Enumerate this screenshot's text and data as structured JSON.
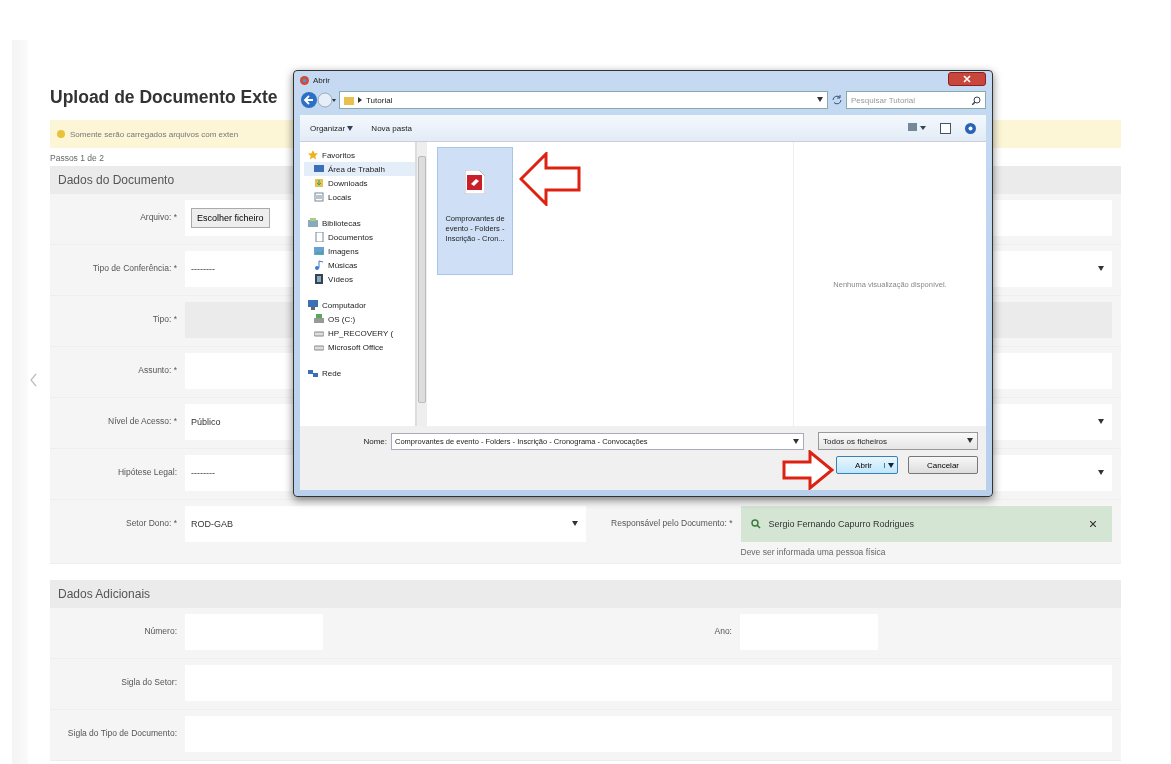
{
  "page": {
    "title": "Upload de Documento Exte",
    "alert": "Somente serão carregados arquivos com exten",
    "steps": "Passos 1 de 2"
  },
  "sections": [
    {
      "title": "Dados do Documento",
      "rows": [
        {
          "fields": [
            {
              "kind": "file",
              "label": "Arquivo: *",
              "value": "Escolher ficheiro"
            }
          ]
        },
        {
          "fields": [
            {
              "kind": "select",
              "label": "Tipo de Conferência: *",
              "value": "--------"
            }
          ]
        },
        {
          "fields": [
            {
              "kind": "disabled",
              "label": "Tipo: *"
            }
          ]
        },
        {
          "fields": [
            {
              "kind": "text",
              "label": "Assunto: *"
            }
          ]
        },
        {
          "fields": [
            {
              "kind": "select",
              "label": "Nível de Acesso: *",
              "value": "Público"
            }
          ]
        },
        {
          "fields": [
            {
              "kind": "select",
              "label": "Hipótese Legal:",
              "value": "--------"
            }
          ]
        },
        {
          "fields": [
            {
              "kind": "select",
              "label": "Setor Dono: *",
              "value": "ROD-GAB"
            },
            {
              "kind": "person",
              "label": "Responsável pelo Documento: *",
              "value": "Sergio Fernando Capurro Rodrigues",
              "help": "Deve ser informada uma pessoa física"
            }
          ]
        }
      ]
    },
    {
      "title": "Dados Adicionais",
      "rows": [
        {
          "fields": [
            {
              "kind": "short",
              "label": "Número:"
            },
            {
              "kind": "short",
              "label": "Ano:"
            }
          ]
        },
        {
          "fields": [
            {
              "kind": "text",
              "label": "Sigla do Setor:"
            }
          ]
        },
        {
          "fields": [
            {
              "kind": "text",
              "label": "Sigla do Tipo de Documento:"
            }
          ]
        }
      ]
    }
  ],
  "dialog": {
    "title": "Abrir",
    "path": "Tutorial",
    "search_placeholder": "Pesquisar Tutorial",
    "toolbar": [
      "Organizar",
      "Nova pasta"
    ],
    "nav": [
      {
        "kind": "star",
        "label": "Favoritos",
        "selected": false,
        "children": [
          {
            "kind": "desktop",
            "label": "Área de Trabalh",
            "selected": true
          },
          {
            "kind": "download",
            "label": "Downloads",
            "selected": false
          },
          {
            "kind": "places",
            "label": "Locais",
            "selected": false
          }
        ]
      },
      {
        "kind": "library",
        "label": "Bibliotecas",
        "selected": false,
        "children": [
          {
            "kind": "doc",
            "label": "Documentos",
            "selected": false
          },
          {
            "kind": "image",
            "label": "Imagens",
            "selected": false
          },
          {
            "kind": "music",
            "label": "Músicas",
            "selected": false
          },
          {
            "kind": "video",
            "label": "Vídeos",
            "selected": false
          }
        ]
      },
      {
        "kind": "computer",
        "label": "Computador",
        "selected": false,
        "children": [
          {
            "kind": "disk",
            "label": "OS (C:)",
            "selected": false
          },
          {
            "kind": "drive",
            "label": "HP_RECOVERY (",
            "selected": false
          },
          {
            "kind": "drive",
            "label": "Microsoft Office",
            "selected": false
          }
        ]
      },
      {
        "kind": "network",
        "label": "Rede",
        "selected": false
      }
    ],
    "files": [
      {
        "name": "Comprovantes de evento - Folders - Inscrição - Cron...",
        "selected": true
      }
    ],
    "preview": "Nenhuma visualização disponível.",
    "name_label": "Nome:",
    "name_value": "Comprovantes de evento - Folders - Inscrição - Cronograma - Convocações",
    "filter": "Todos os ficheiros",
    "buttons": [
      {
        "label": "Abrir",
        "kind": "split"
      },
      {
        "label": "Cancelar",
        "kind": "plain"
      }
    ]
  }
}
